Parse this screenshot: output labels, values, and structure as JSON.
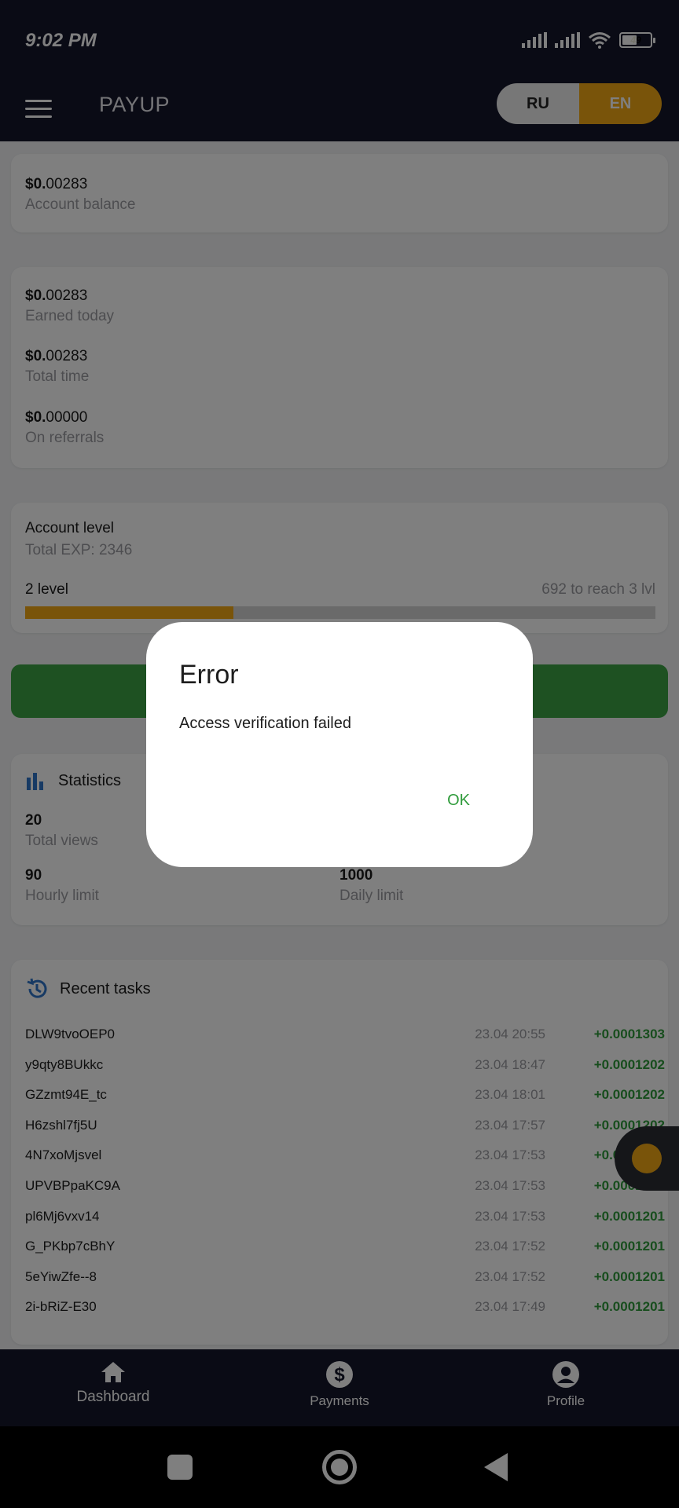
{
  "status": {
    "time": "9:02 PM",
    "battery": "49"
  },
  "app": {
    "title": "PAYUP",
    "lang_ru": "RU",
    "lang_en": "EN"
  },
  "balance": {
    "value_prefix": "$0.",
    "value_rest": "00283",
    "label": "Account balance"
  },
  "earnings": [
    {
      "prefix": "$0.",
      "rest": "00283",
      "label": "Earned today"
    },
    {
      "prefix": "$0.",
      "rest": "00283",
      "label": "Total time"
    },
    {
      "prefix": "$0.",
      "rest": "00000",
      "label": "On referrals"
    }
  ],
  "level": {
    "title": "Account level",
    "exp": "Total EXP: 2346",
    "current": "2 level",
    "remaining": "692 to reach 3 lvl",
    "progress_fraction": 0.33
  },
  "statistics": {
    "title": "Statistics",
    "items": [
      {
        "value": "20",
        "label": "Total views"
      },
      {
        "value": "90",
        "label": "Hourly limit"
      },
      {
        "value": "1000",
        "label": "Daily limit"
      }
    ]
  },
  "tasks": {
    "title": "Recent tasks",
    "rows": [
      {
        "id": "DLW9tvoOEP0",
        "time": "23.04 20:55",
        "amount": "+0.0001303"
      },
      {
        "id": "y9qty8BUkkc",
        "time": "23.04 18:47",
        "amount": "+0.0001202"
      },
      {
        "id": "GZzmt94E_tc",
        "time": "23.04 18:01",
        "amount": "+0.0001202"
      },
      {
        "id": "H6zshl7fj5U",
        "time": "23.04 17:57",
        "amount": "+0.0001202"
      },
      {
        "id": "4N7xoMjsvel",
        "time": "23.04 17:53",
        "amount": "+0.0001202"
      },
      {
        "id": "UPVBPpaKC9A",
        "time": "23.04 17:53",
        "amount": "+0.0001202"
      },
      {
        "id": "pl6Mj6vxv14",
        "time": "23.04 17:53",
        "amount": "+0.0001201"
      },
      {
        "id": "G_PKbp7cBhY",
        "time": "23.04 17:52",
        "amount": "+0.0001201"
      },
      {
        "id": "5eYiwZfe--8",
        "time": "23.04 17:52",
        "amount": "+0.0001201"
      },
      {
        "id": "2i-bRiZ-E30",
        "time": "23.04 17:49",
        "amount": "+0.0001201"
      }
    ]
  },
  "nav": {
    "dashboard": "Dashboard",
    "payments": "Payments",
    "profile": "Profile"
  },
  "dialog": {
    "title": "Error",
    "message": "Access verification failed",
    "ok": "OK"
  },
  "colors": {
    "accent": "#f3a915",
    "dark": "#15172a",
    "green": "#3da345"
  }
}
